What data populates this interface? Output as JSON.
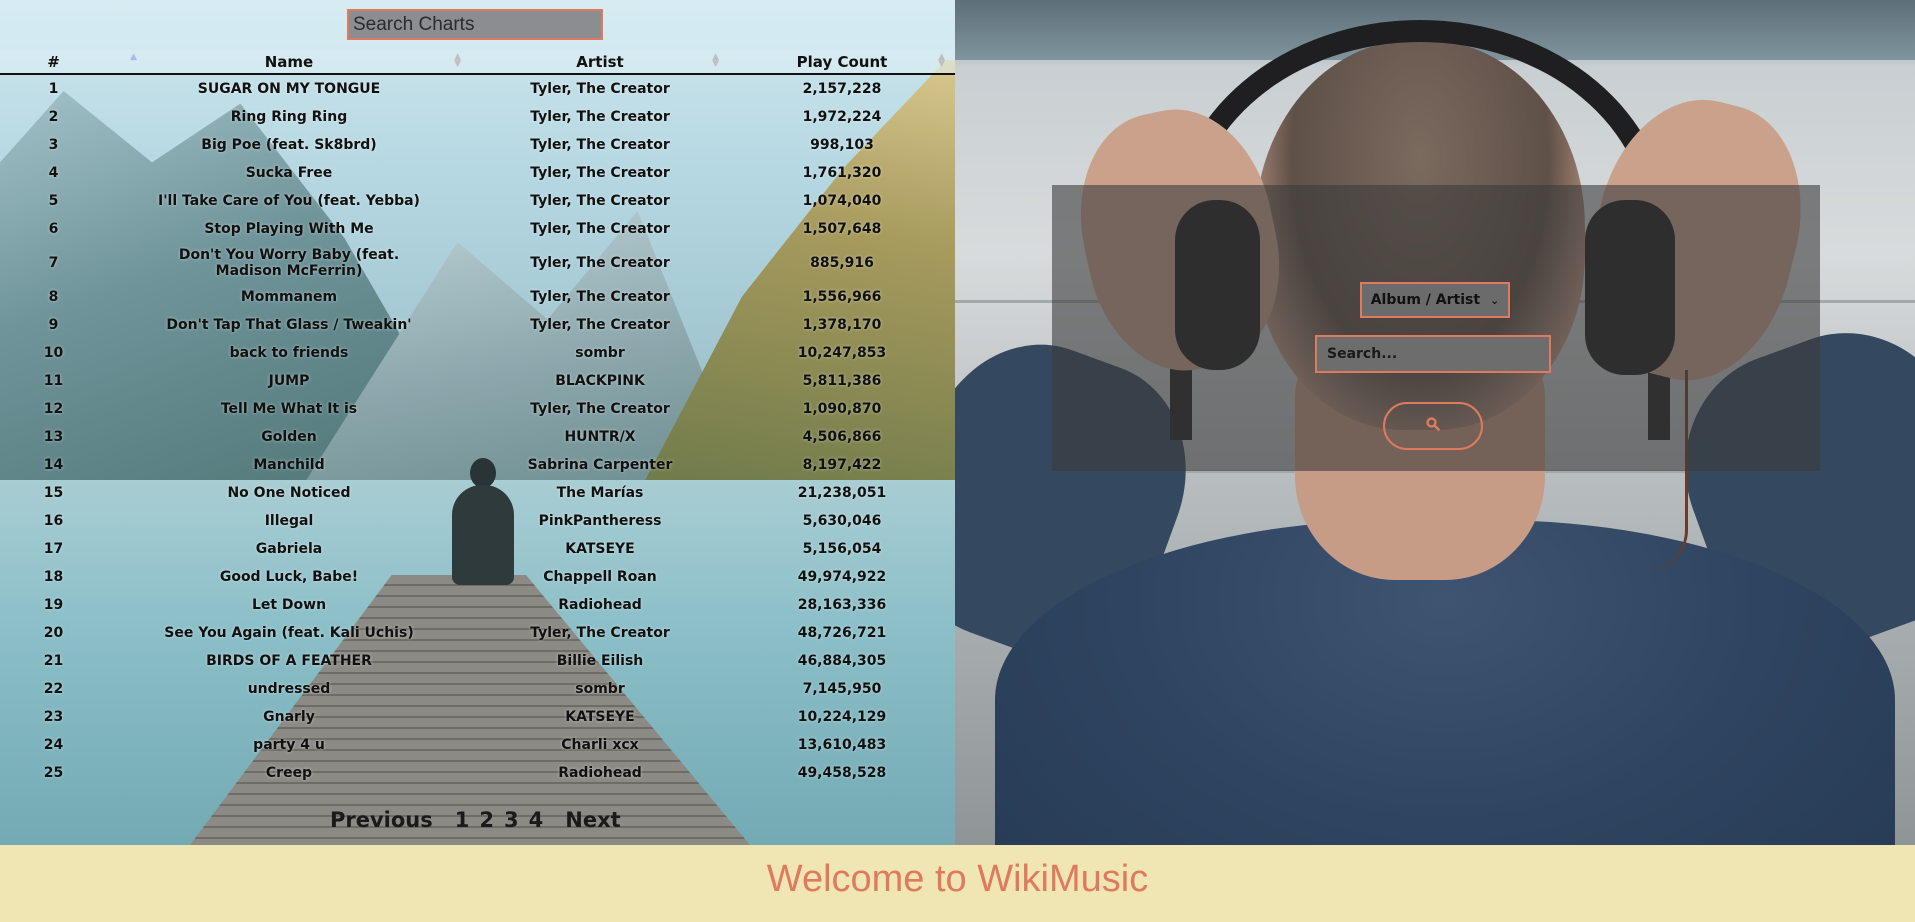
{
  "charts": {
    "search_placeholder": "Search Charts",
    "columns": [
      "#",
      "Name",
      "Artist",
      "Play Count"
    ],
    "rows": [
      {
        "rank": "1",
        "name": "SUGAR ON MY TONGUE",
        "artist": "Tyler, The Creator",
        "plays": "2,157,228"
      },
      {
        "rank": "2",
        "name": "Ring Ring Ring",
        "artist": "Tyler, The Creator",
        "plays": "1,972,224"
      },
      {
        "rank": "3",
        "name": "Big Poe (feat. Sk8brd)",
        "artist": "Tyler, The Creator",
        "plays": "998,103"
      },
      {
        "rank": "4",
        "name": "Sucka Free",
        "artist": "Tyler, The Creator",
        "plays": "1,761,320"
      },
      {
        "rank": "5",
        "name": "I'll Take Care of You (feat. Yebba)",
        "artist": "Tyler, The Creator",
        "plays": "1,074,040"
      },
      {
        "rank": "6",
        "name": "Stop Playing With Me",
        "artist": "Tyler, The Creator",
        "plays": "1,507,648"
      },
      {
        "rank": "7",
        "name": "Don't You Worry Baby (feat. Madison McFerrin)",
        "artist": "Tyler, The Creator",
        "plays": "885,916"
      },
      {
        "rank": "8",
        "name": "Mommanem",
        "artist": "Tyler, The Creator",
        "plays": "1,556,966"
      },
      {
        "rank": "9",
        "name": "Don't Tap That Glass / Tweakin'",
        "artist": "Tyler, The Creator",
        "plays": "1,378,170"
      },
      {
        "rank": "10",
        "name": "back to friends",
        "artist": "sombr",
        "plays": "10,247,853"
      },
      {
        "rank": "11",
        "name": "JUMP",
        "artist": "BLACKPINK",
        "plays": "5,811,386"
      },
      {
        "rank": "12",
        "name": "Tell Me What It is",
        "artist": "Tyler, The Creator",
        "plays": "1,090,870"
      },
      {
        "rank": "13",
        "name": "Golden",
        "artist": "HUNTR/X",
        "plays": "4,506,866"
      },
      {
        "rank": "14",
        "name": "Manchild",
        "artist": "Sabrina Carpenter",
        "plays": "8,197,422"
      },
      {
        "rank": "15",
        "name": "No One Noticed",
        "artist": "The Marías",
        "plays": "21,238,051"
      },
      {
        "rank": "16",
        "name": "Illegal",
        "artist": "PinkPantheress",
        "plays": "5,630,046"
      },
      {
        "rank": "17",
        "name": "Gabriela",
        "artist": "KATSEYE",
        "plays": "5,156,054"
      },
      {
        "rank": "18",
        "name": "Good Luck, Babe!",
        "artist": "Chappell Roan",
        "plays": "49,974,922"
      },
      {
        "rank": "19",
        "name": "Let Down",
        "artist": "Radiohead",
        "plays": "28,163,336"
      },
      {
        "rank": "20",
        "name": "See You Again (feat. Kali Uchis)",
        "artist": "Tyler, The Creator",
        "plays": "48,726,721"
      },
      {
        "rank": "21",
        "name": "BIRDS OF A FEATHER",
        "artist": "Billie Eilish",
        "plays": "46,884,305"
      },
      {
        "rank": "22",
        "name": "undressed",
        "artist": "sombr",
        "plays": "7,145,950"
      },
      {
        "rank": "23",
        "name": "Gnarly",
        "artist": "KATSEYE",
        "plays": "10,224,129"
      },
      {
        "rank": "24",
        "name": "party 4 u",
        "artist": "Charli xcx",
        "plays": "13,610,483"
      },
      {
        "rank": "25",
        "name": "Creep",
        "artist": "Radiohead",
        "plays": "49,458,528"
      }
    ],
    "pagination": {
      "previous": "Previous",
      "pages": [
        "1",
        "2",
        "3",
        "4"
      ],
      "next": "Next"
    }
  },
  "search_panel": {
    "type_select": "Album / Artist",
    "search_placeholder": "Search...",
    "search_icon": "magnifier-icon"
  },
  "footer": {
    "title": "Welcome to WikiMusic"
  },
  "colors": {
    "accent": "#e07a5f",
    "footer_bg": "#efe6b3"
  }
}
